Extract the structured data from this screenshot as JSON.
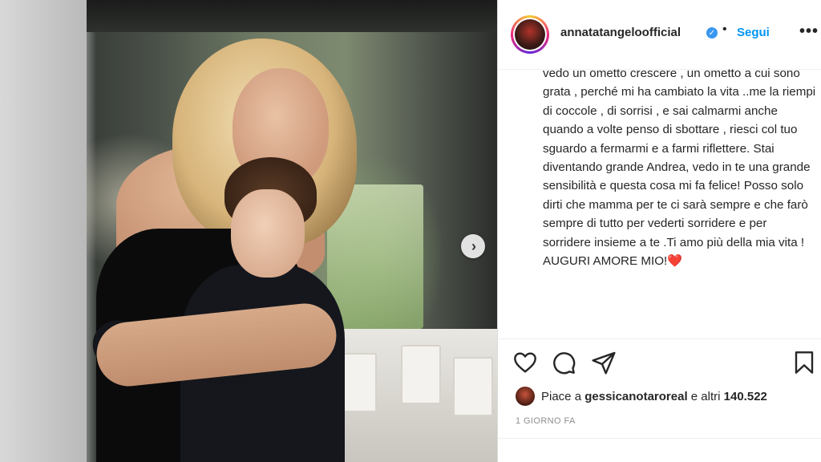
{
  "post": {
    "username": "annatatangeloofficial",
    "verified_icon": "check-icon",
    "separator": "•",
    "follow_label": "Segui",
    "more_label": "•••",
    "caption": "vedo un ometto crescere , un ometto a cui sono grata , perché mi ha cambiato la vita ..me la riempi di coccole , di sorrisi , e sai calmarmi anche quando a volte penso di sbottare , riesci col tuo sguardo a fermarmi e a farmi riflettere. Stai diventando grande Andrea, vedo in te una grande sensibilità e questa cosa mi fa felice! Posso solo dirti che mamma per te ci sarà sempre e che farò sempre di tutto per vederti sorridere e per sorridere insieme a te .Ti amo più della mia vita ! AUGURI AMORE MIO!❤️",
    "likes_prefix": "Piace a",
    "likes_user": "gessicanotaroreal",
    "likes_middle": "e altri",
    "likes_count": "140.522",
    "timestamp": "1 GIORNO FA"
  },
  "photo": {
    "next_label": "›"
  },
  "icons": [
    "heart-icon",
    "comment-icon",
    "share-icon",
    "bookmark-icon",
    "chevron-right-icon",
    "verified-badge-icon"
  ]
}
